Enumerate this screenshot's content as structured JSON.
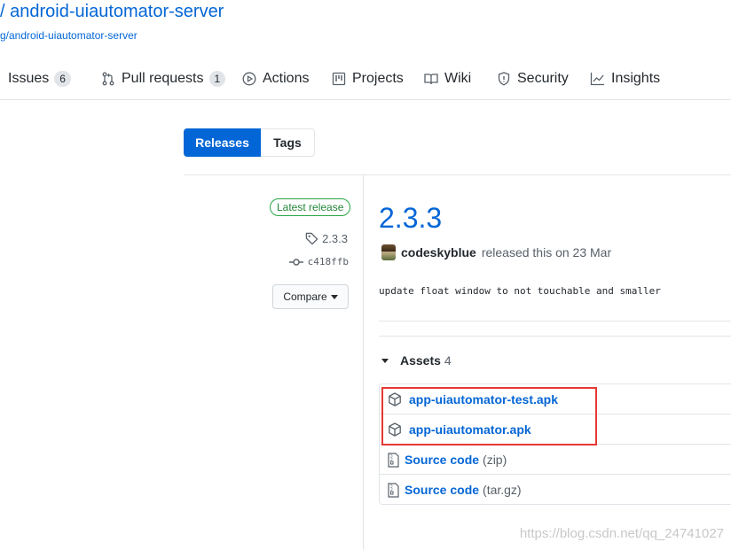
{
  "header": {
    "slash": "/",
    "repo_name": "android-uiautomator-server",
    "fork_text": "g/android-uiautomator-server"
  },
  "nav": {
    "issues": {
      "label": "Issues",
      "count": "6"
    },
    "pulls": {
      "label": "Pull requests",
      "count": "1"
    },
    "actions": {
      "label": "Actions"
    },
    "projects": {
      "label": "Projects"
    },
    "wiki": {
      "label": "Wiki"
    },
    "security": {
      "label": "Security"
    },
    "insights": {
      "label": "Insights"
    }
  },
  "subnav": {
    "releases": "Releases",
    "tags": "Tags"
  },
  "sidebar": {
    "badge": "Latest release",
    "tag": "2.3.3",
    "commit": "c418ffb",
    "compare": "Compare"
  },
  "release": {
    "title": "2.3.3",
    "author": "codeskyblue",
    "released_text": "released this on 23 Mar",
    "notes": "update float window to not touchable and smaller"
  },
  "assets": {
    "label": "Assets",
    "count": "4",
    "items": [
      {
        "name": "app-uiautomator-test.apk",
        "suffix": ""
      },
      {
        "name": "app-uiautomator.apk",
        "suffix": ""
      },
      {
        "name": "Source code",
        "suffix": "(zip)"
      },
      {
        "name": "Source code",
        "suffix": "(tar.gz)"
      }
    ]
  },
  "watermark": "https://blog.csdn.net/qq_24741027",
  "colors": {
    "link": "#0366d6",
    "accent": "#0366d6",
    "highlight": "#e53935",
    "badge": "#28a745"
  }
}
